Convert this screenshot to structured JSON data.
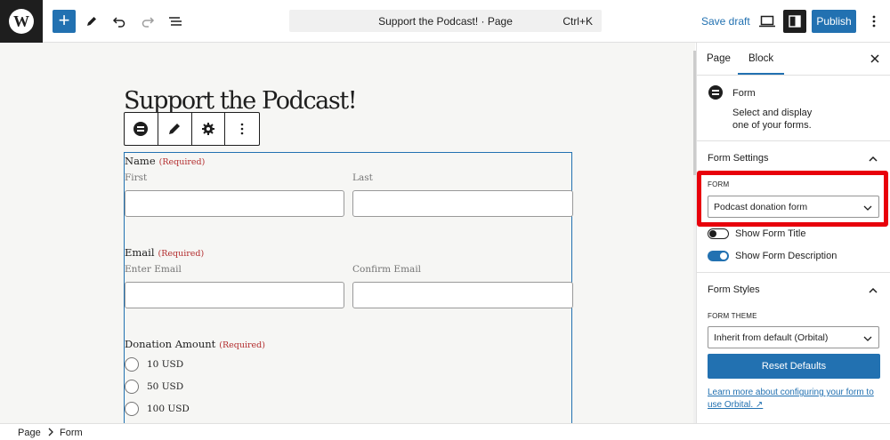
{
  "topbar": {
    "logo_letter": "W",
    "document_title": "Support the Podcast! · Page",
    "shortcut": "Ctrl+K",
    "save_draft": "Save draft",
    "publish": "Publish",
    "add_symbol": "+"
  },
  "canvas": {
    "page_title": "Support the Podcast!",
    "form": {
      "name": {
        "label": "Name",
        "required": "(Required)",
        "first": "First",
        "last": "Last"
      },
      "email": {
        "label": "Email",
        "required": "(Required)",
        "enter": "Enter Email",
        "confirm": "Confirm Email"
      },
      "donation": {
        "label": "Donation Amount",
        "required": "(Required)",
        "options": [
          "10 USD",
          "50 USD",
          "100 USD"
        ]
      }
    }
  },
  "sidebar": {
    "tabs": [
      "Page",
      "Block"
    ],
    "active_tab": "Block",
    "block": {
      "name": "Form",
      "description": "Select and display one of your forms."
    },
    "form_settings": {
      "heading": "Form Settings",
      "form_label": "FORM",
      "form_value": "Podcast donation form",
      "toggles": [
        {
          "label": "Show Form Title",
          "on": false
        },
        {
          "label": "Show Form Description",
          "on": true
        }
      ]
    },
    "form_styles": {
      "heading": "Form Styles",
      "theme_label": "FORM THEME",
      "theme_value": "Inherit from default (Orbital)",
      "reset": "Reset Defaults",
      "learn_more": "Learn more about configuring your form to use Orbital. ↗"
    }
  },
  "footer": {
    "crumbs": [
      "Page",
      "Form"
    ]
  },
  "colors": {
    "accent": "#2271b1",
    "required": "#b32d2e",
    "highlight": "#e8000b"
  }
}
